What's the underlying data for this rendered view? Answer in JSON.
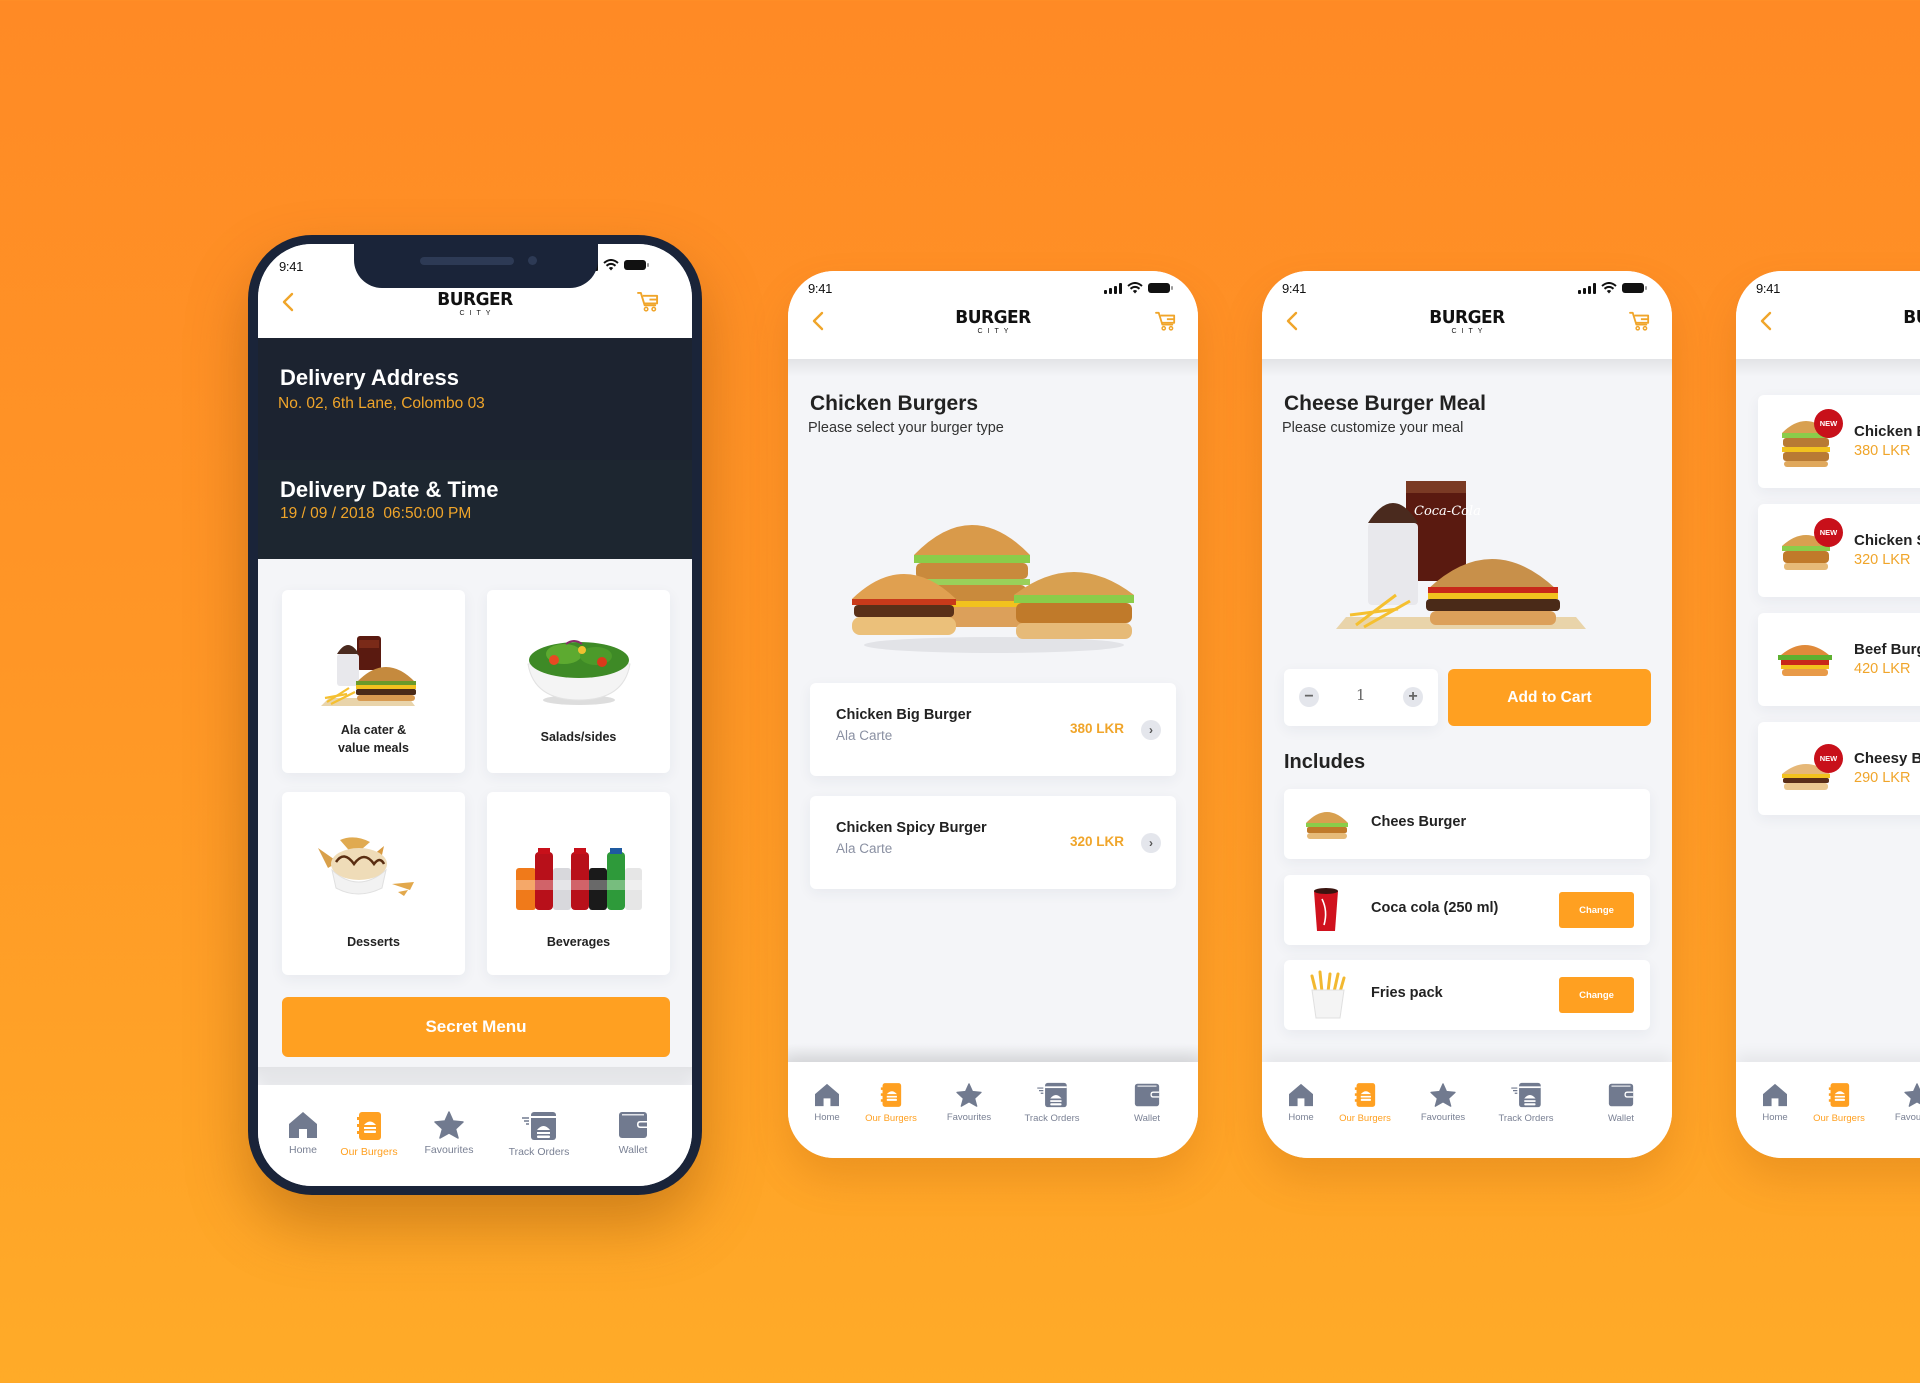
{
  "brand": {
    "name_line1": "BURGER",
    "name_line2": "CITY"
  },
  "status_bar": {
    "time": "9:41"
  },
  "colors": {
    "accent": "#FFA021",
    "price": "#F0A52A",
    "dark": "#1A2439",
    "new_badge": "#C8101A",
    "bg_top": "#FF8A25",
    "bg_bottom": "#FFAB28"
  },
  "nav": {
    "items": [
      {
        "label": "Home",
        "icon": "home-icon"
      },
      {
        "label": "Our Burgers",
        "icon": "burger-menu-book-icon",
        "active": true
      },
      {
        "label": "Favourites",
        "icon": "star-icon"
      },
      {
        "label": "Track Orders",
        "icon": "delivery-box-icon"
      },
      {
        "label": "Wallet",
        "icon": "wallet-icon"
      }
    ]
  },
  "screen_home": {
    "delivery_address": {
      "title": "Delivery Address",
      "value": "No. 02, 6th Lane, Colombo 03"
    },
    "delivery_datetime": {
      "title": "Delivery Date & Time",
      "value": "19 / 09 / 2018  06:50:00 PM"
    },
    "categories": [
      {
        "label_line1": "Ala cater &",
        "label_line2": "value meals",
        "icon": "meal-combo-image"
      },
      {
        "label_line1": "Salads/sides",
        "label_line2": "",
        "icon": "salad-image"
      },
      {
        "label_line1": "Desserts",
        "label_line2": "",
        "icon": "dessert-image"
      },
      {
        "label_line1": "Beverages",
        "label_line2": "",
        "icon": "beverages-image"
      }
    ],
    "secret_menu_label": "Secret Menu"
  },
  "screen_chicken": {
    "title": "Chicken Burgers",
    "subtitle": "Please select your burger type",
    "items": [
      {
        "name": "Chicken Big Burger",
        "type": "Ala Carte",
        "price": "380 LKR"
      },
      {
        "name": "Chicken Spicy Burger",
        "type": "Ala Carte",
        "price": "320 LKR"
      }
    ]
  },
  "screen_meal": {
    "title": "Cheese Burger Meal",
    "subtitle": "Please customize your meal",
    "quantity": "1",
    "minus": "−",
    "plus": "+",
    "add_to_cart_label": "Add to Cart",
    "includes_title": "Includes",
    "includes": [
      {
        "name": "Chees Burger",
        "change": ""
      },
      {
        "name": "Coca cola (250 ml)",
        "change": "Change"
      },
      {
        "name": "Fries pack",
        "change": "Change"
      }
    ]
  },
  "screen_list": {
    "items": [
      {
        "name": "Chicken Big Burger",
        "price": "380 LKR",
        "badge": "NEW"
      },
      {
        "name": "Chicken Spicy Burger",
        "price": "320 LKR",
        "badge": "NEW"
      },
      {
        "name": "Beef Burger",
        "price": "420 LKR",
        "badge": ""
      },
      {
        "name": "Cheesy Burger",
        "price": "290 LKR",
        "badge": "NEW"
      }
    ]
  }
}
